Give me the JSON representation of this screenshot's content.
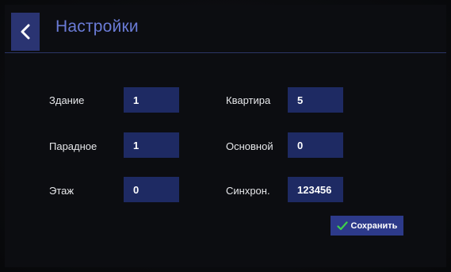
{
  "header": {
    "title": "Настройки"
  },
  "form": {
    "building_label": "Здание",
    "building_value": "1",
    "apartment_label": "Квартира",
    "apartment_value": "5",
    "entrance_label": "Парадное",
    "entrance_value": "1",
    "main_label": "Основной",
    "main_value": "0",
    "floor_label": "Этаж",
    "floor_value": "0",
    "sync_label": "Синхрон.",
    "sync_value": "123456"
  },
  "actions": {
    "save_label": "Сохранить"
  },
  "colors": {
    "accent": "#6a7bd6",
    "field_bg": "#1e2a63",
    "button_bg": "#2d3a8a",
    "check": "#3ed14a"
  },
  "icons": {
    "back": "chevron-left-icon",
    "save": "check-icon"
  }
}
